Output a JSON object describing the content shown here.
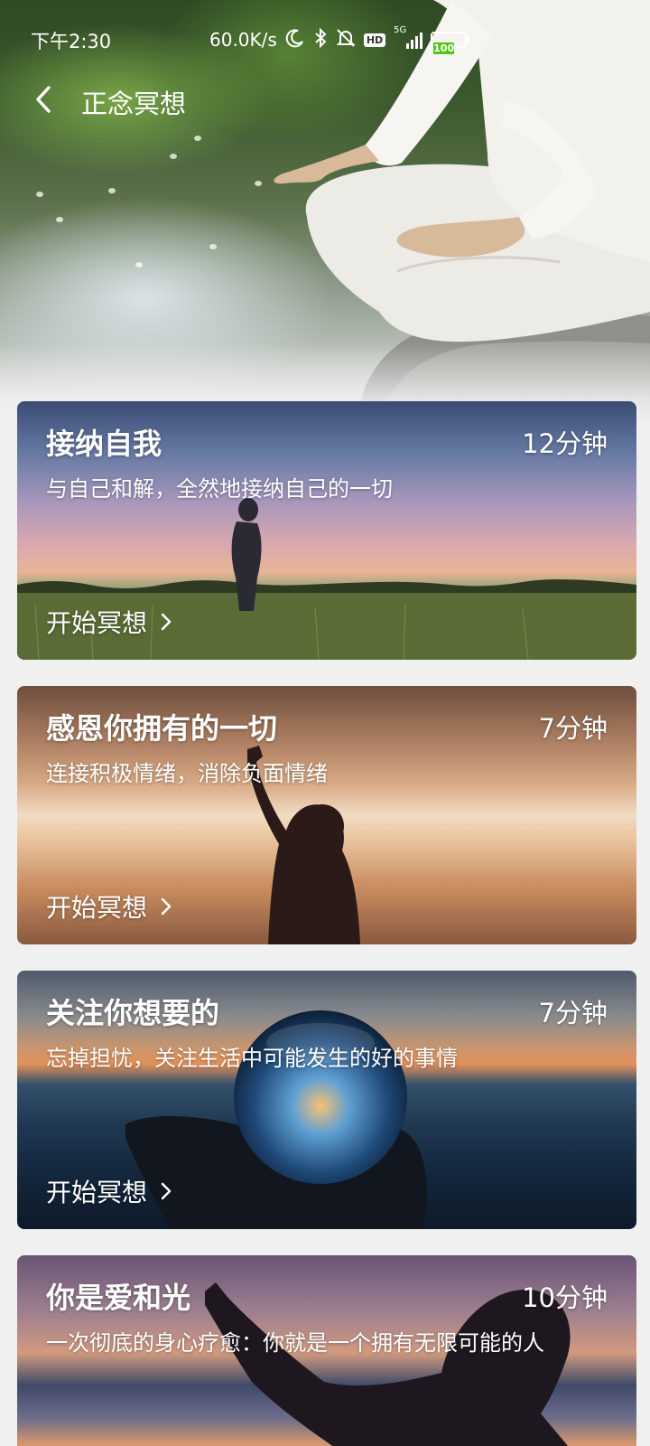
{
  "status_bar": {
    "time": "下午2:30",
    "net_speed": "60.0K/s",
    "hd": "HD",
    "network": "5G",
    "battery": "100",
    "battery_level": 1.0
  },
  "header": {
    "title": "正念冥想"
  },
  "cards": [
    {
      "title": "接纳自我",
      "duration": "12分钟",
      "description": "与自己和解，全然地接纳自己的一切",
      "action": "开始冥想"
    },
    {
      "title": "感恩你拥有的一切",
      "duration": "7分钟",
      "description": "连接积极情绪，消除负面情绪",
      "action": "开始冥想"
    },
    {
      "title": "关注你想要的",
      "duration": "7分钟",
      "description": "忘掉担忧，关注生活中可能发生的好的事情",
      "action": "开始冥想"
    },
    {
      "title": "你是爱和光",
      "duration": "10分钟",
      "description": "一次彻底的身心疗愈：你就是一个拥有无限可能的人",
      "action": ""
    }
  ],
  "colors": {
    "page_bg": "#f0f0f0",
    "battery_green": "#52c41a",
    "text_on_image": "#ffffff"
  },
  "icons": [
    "moon-icon",
    "bluetooth-icon",
    "bell-off-icon",
    "signal-icon",
    "battery-icon",
    "back-arrow-icon",
    "chevron-right-icon"
  ]
}
